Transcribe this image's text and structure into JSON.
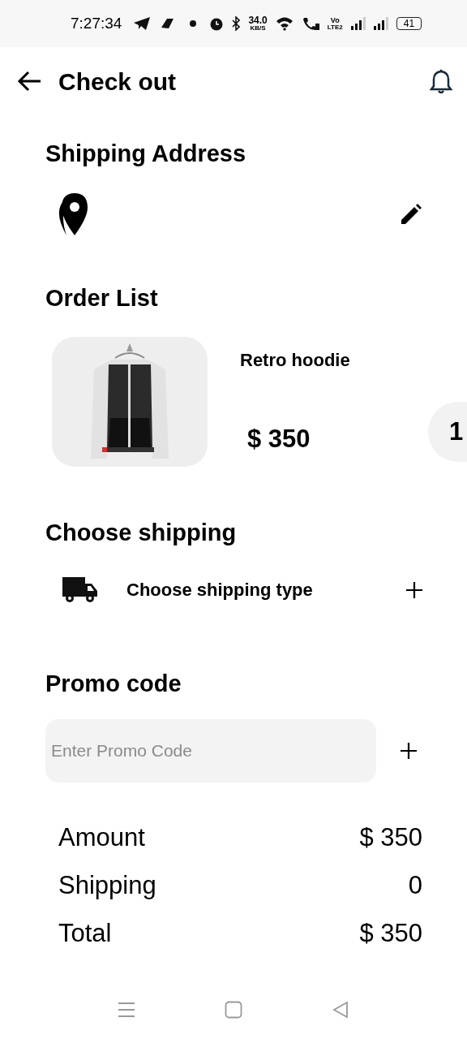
{
  "status_bar": {
    "time": "7:27:34",
    "speed": "34.0",
    "speed_unit": "KB/S",
    "network_top": "Vo",
    "network_bottom": "LTE2",
    "battery": "41"
  },
  "header": {
    "title": "Check out"
  },
  "shipping_address": {
    "heading": "Shipping Address"
  },
  "order_list": {
    "heading": "Order List",
    "items": [
      {
        "kind": "picture",
        "name": "Retro hoodie",
        "price": "$ 350",
        "quantity": "1"
      }
    ]
  },
  "choose_shipping": {
    "heading": "Choose shipping",
    "option": "Choose shipping type"
  },
  "promo_code": {
    "heading": "Promo code",
    "placeholder": "Enter Promo Code"
  },
  "summary": [
    {
      "label": "Amount",
      "value": "$ 350"
    },
    {
      "label": "Shipping",
      "value": "0"
    },
    {
      "label": "Total",
      "value": "$ 350"
    }
  ]
}
